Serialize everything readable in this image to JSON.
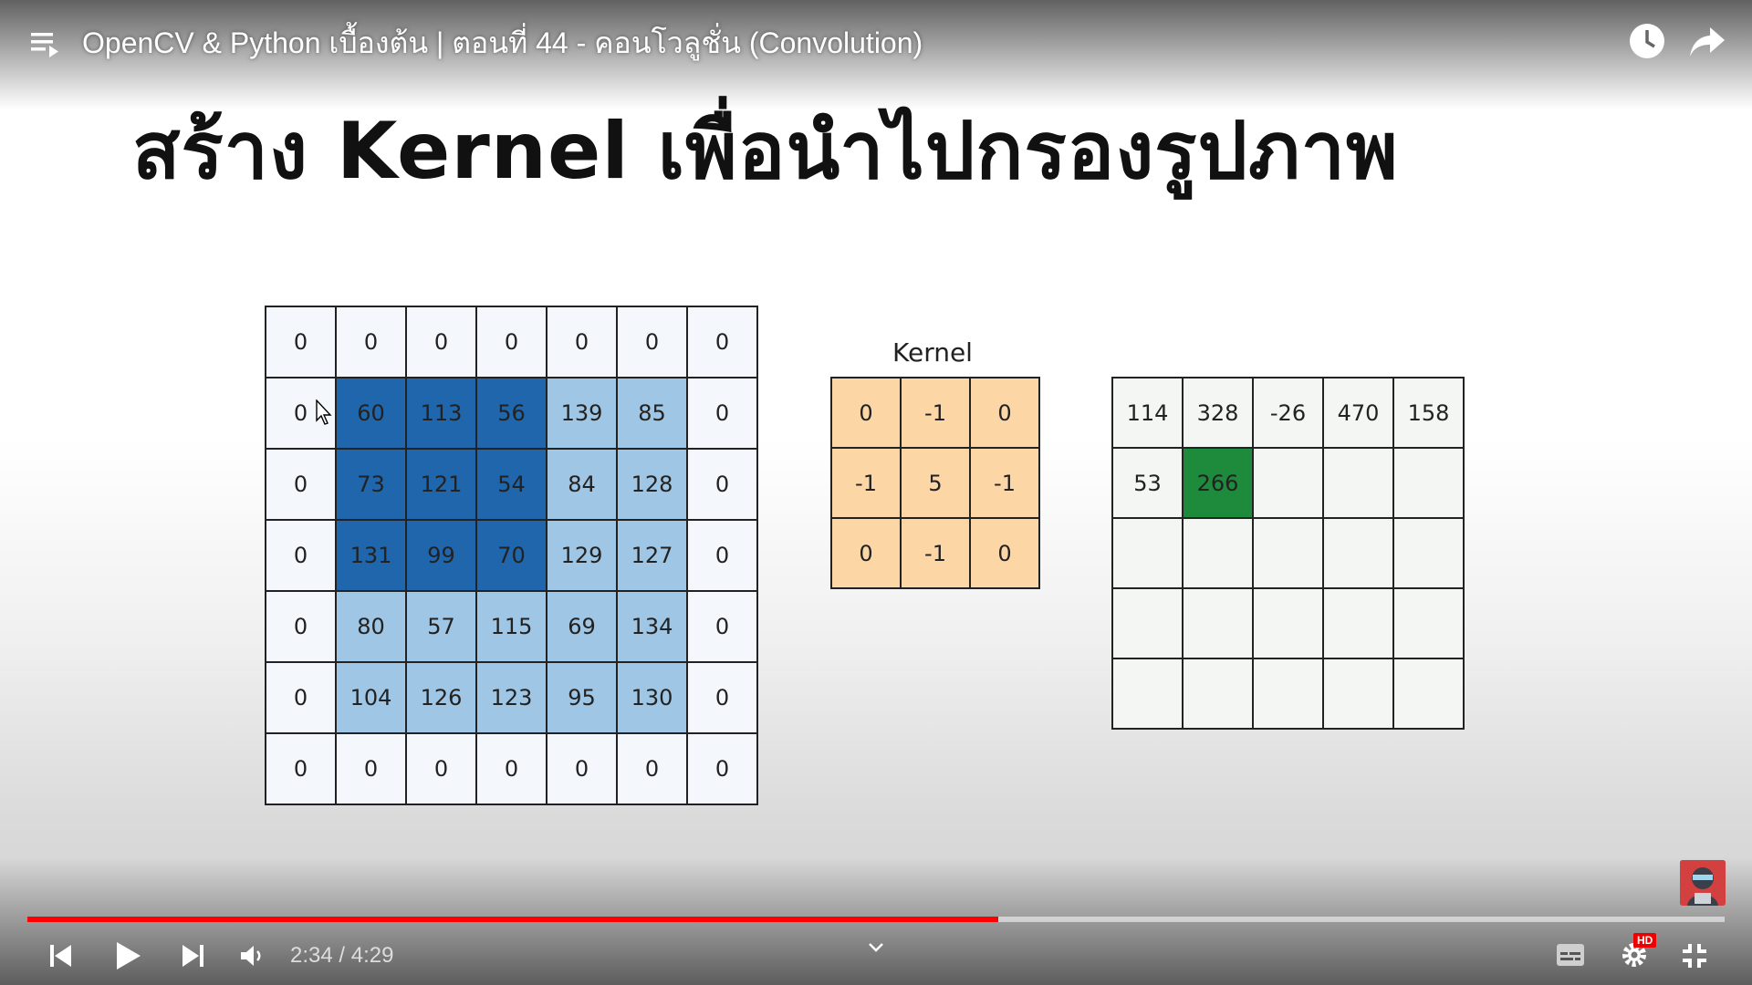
{
  "player": {
    "title": "OpenCV & Python เบื้องต้น | ตอนที่ 44 - คอนโวลูชั่น (Convolution)",
    "current_time": "2:34",
    "duration": "4:29",
    "time_display": "2:34 / 4:29",
    "progress_fraction": 0.572,
    "hd_badge": "HD",
    "accent_color": "#ff0000",
    "icons": {
      "playlist": "playlist-icon",
      "watch_later": "clock-icon",
      "share": "share-icon",
      "previous": "skip-previous-icon",
      "play": "play-icon",
      "next": "skip-next-icon",
      "volume": "volume-icon",
      "expand": "chevron-down-icon",
      "captions": "captions-icon",
      "settings": "gear-icon",
      "fullscreen_exit": "exit-fullscreen-icon"
    }
  },
  "slide": {
    "heading": "สร้าง Kernel เพื่อนำไปกรองรูปภาพ",
    "kernel_label": "Kernel",
    "input_matrix": [
      [
        "0",
        "0",
        "0",
        "0",
        "0",
        "0",
        "0"
      ],
      [
        "0",
        "60",
        "113",
        "56",
        "139",
        "85",
        "0"
      ],
      [
        "0",
        "73",
        "121",
        "54",
        "84",
        "128",
        "0"
      ],
      [
        "0",
        "131",
        "99",
        "70",
        "129",
        "127",
        "0"
      ],
      [
        "0",
        "80",
        "57",
        "115",
        "69",
        "134",
        "0"
      ],
      [
        "0",
        "104",
        "126",
        "123",
        "95",
        "130",
        "0"
      ],
      [
        "0",
        "0",
        "0",
        "0",
        "0",
        "0",
        "0"
      ]
    ],
    "input_highlight_window": "rows 1-3, columns 1-3",
    "kernel_matrix": [
      [
        "0",
        "-1",
        "0"
      ],
      [
        "-1",
        "5",
        "-1"
      ],
      [
        "0",
        "-1",
        "0"
      ]
    ],
    "output_matrix": [
      [
        "114",
        "328",
        "-26",
        "470",
        "158"
      ],
      [
        "53",
        "266",
        "",
        "",
        ""
      ],
      [
        "",
        "",
        "",
        "",
        ""
      ],
      [
        "",
        "",
        "",
        "",
        ""
      ],
      [
        "",
        "",
        "",
        "",
        ""
      ]
    ],
    "output_active_cell": "row 1, column 1",
    "colors": {
      "border_cell": "#f4f8fc",
      "inner_cell": "#9fc6e4",
      "highlight_cell": "#1f66ad",
      "kernel_cell": "#fdd6a6",
      "output_cell": "#f3f6f3",
      "output_active": "#1e8a3c"
    }
  }
}
